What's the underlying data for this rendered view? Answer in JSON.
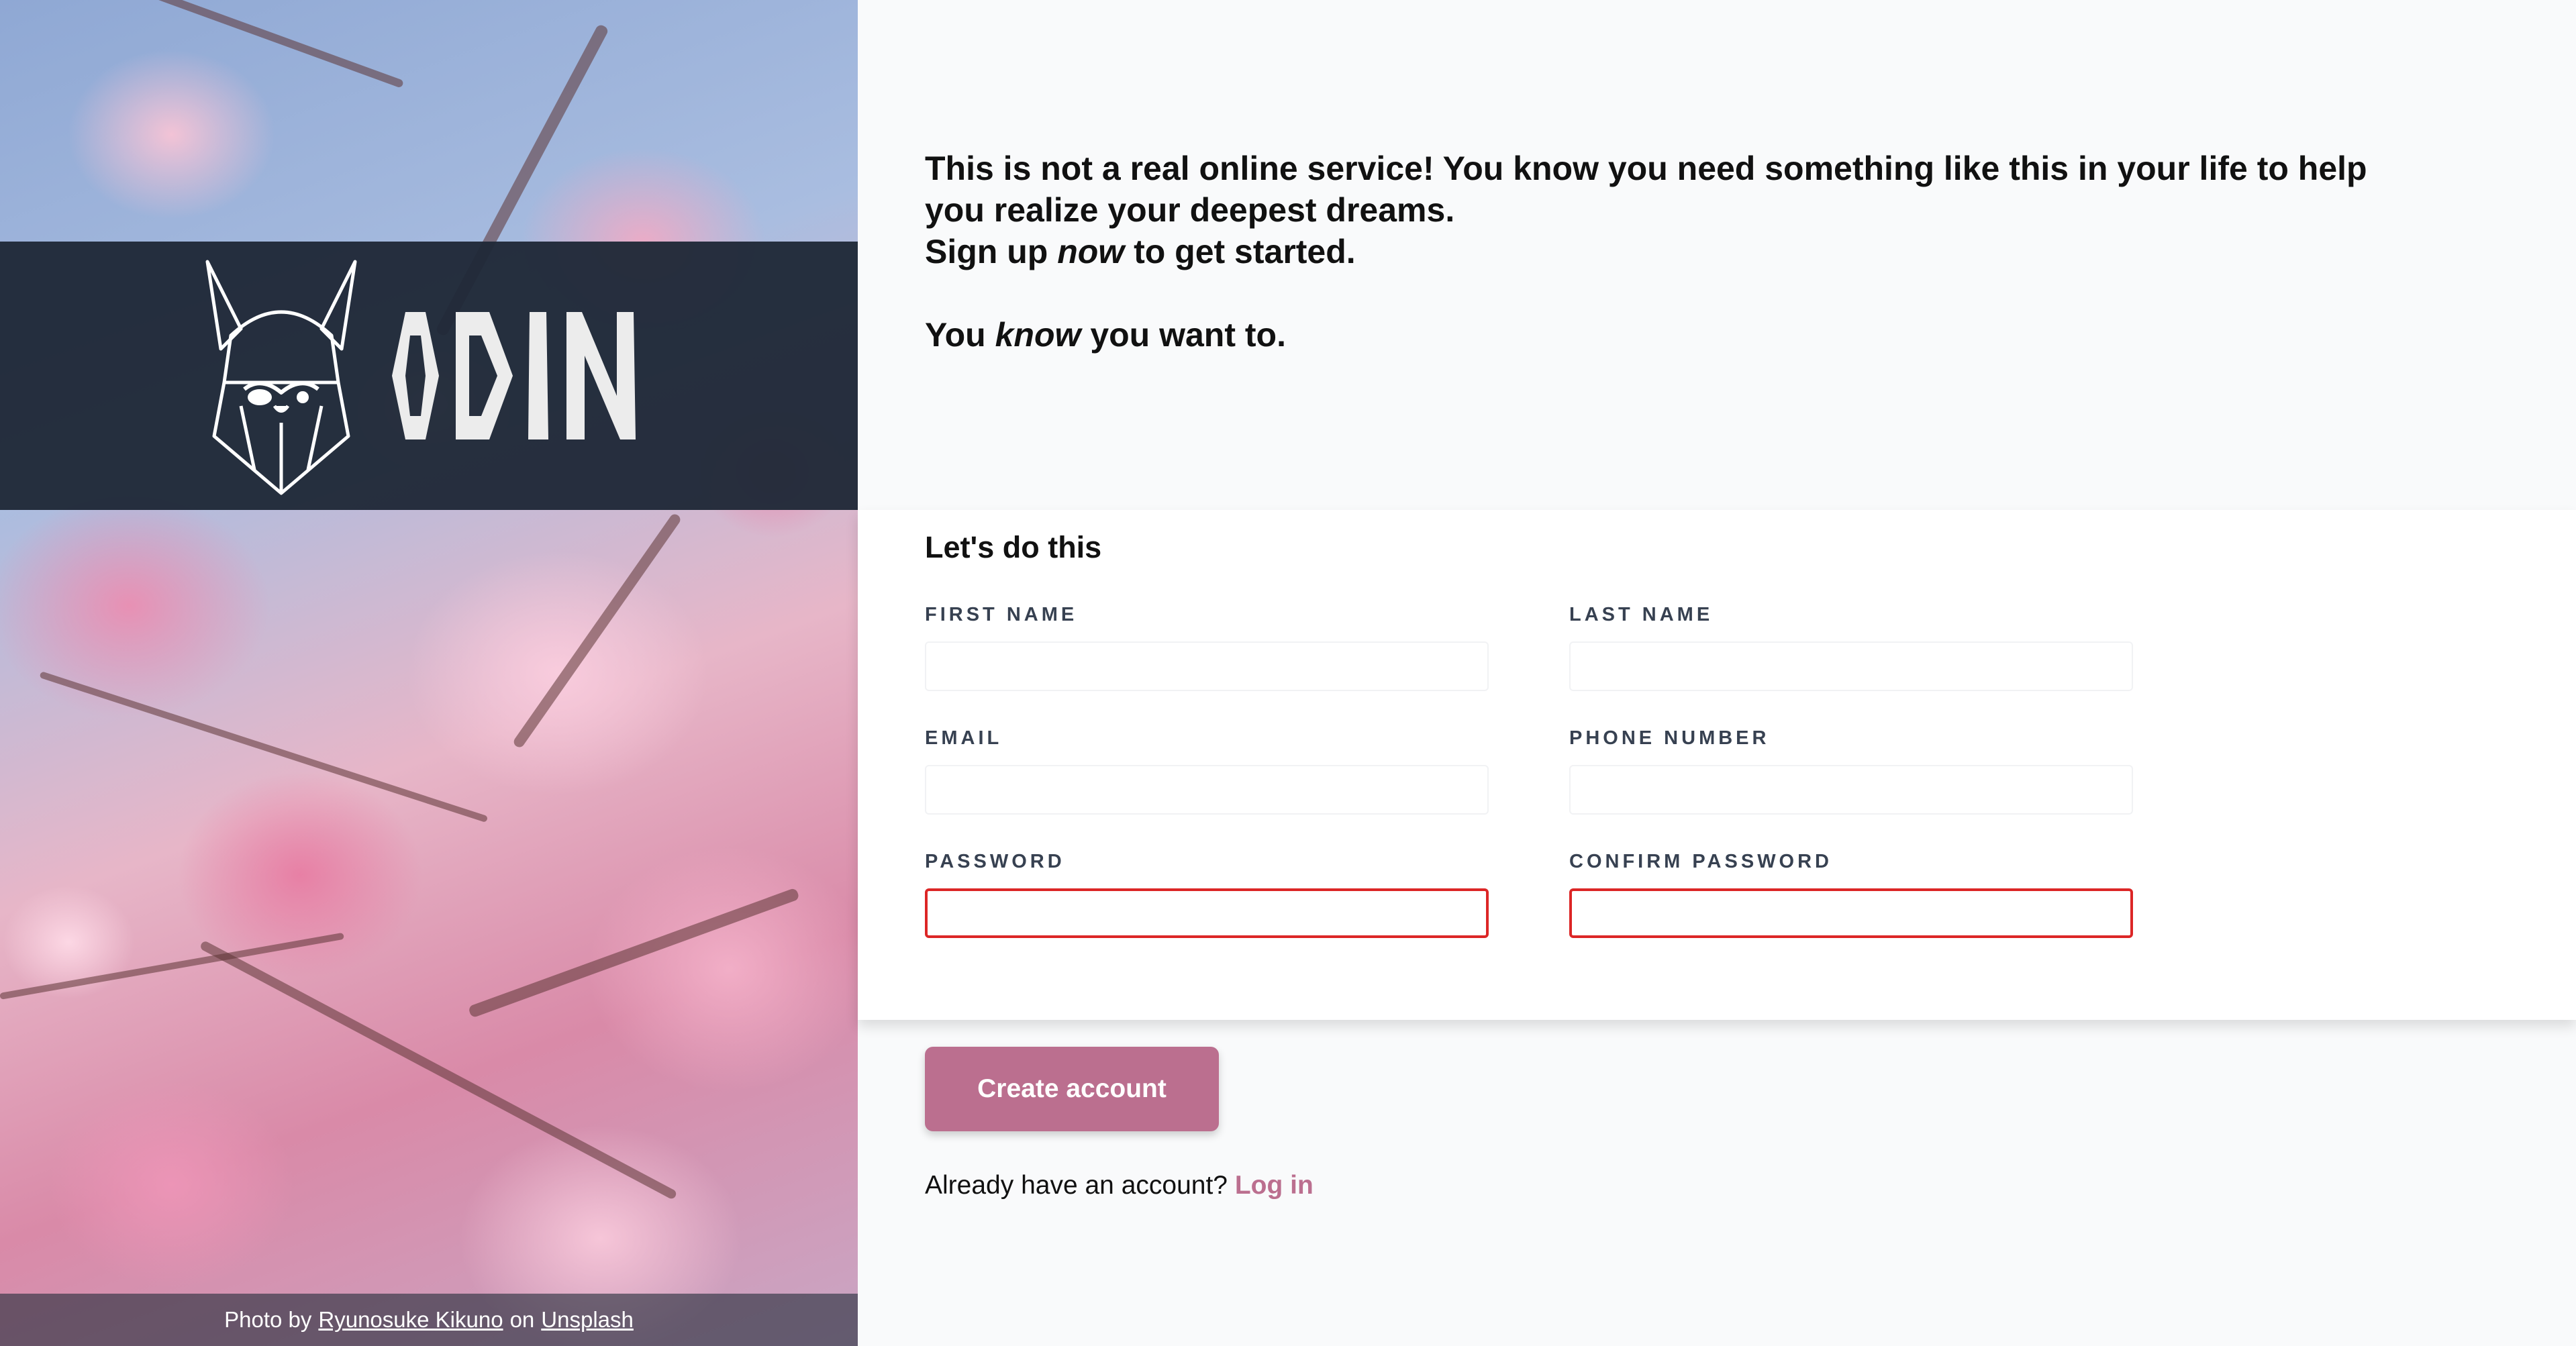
{
  "brand": {
    "name": "ODIN",
    "colors": {
      "accent": "#bb6f8f",
      "dark_band": "#1f2937",
      "error": "#dc2626",
      "page_bg": "#f9fafb"
    }
  },
  "hero": {
    "logo_icon": "viking-helmet-logo-icon",
    "credit": {
      "prefix": "Photo by",
      "author": "Ryunosuke Kikuno",
      "middle": "on",
      "site": "Unsplash"
    }
  },
  "intro": {
    "line1": "This is not a real online service! You know you need something like this in your life to help you realize your deepest dreams.",
    "line2_pre": "Sign up ",
    "line2_em": "now",
    "line2_post": " to get started.",
    "line3_pre": "You ",
    "line3_em": "know",
    "line3_post": " you want to."
  },
  "form": {
    "heading": "Let's do this",
    "fields": {
      "first_name": {
        "label": "FIRST NAME",
        "value": ""
      },
      "last_name": {
        "label": "LAST NAME",
        "value": ""
      },
      "email": {
        "label": "EMAIL",
        "value": ""
      },
      "phone": {
        "label": "PHONE NUMBER",
        "value": ""
      },
      "password": {
        "label": "PASSWORD",
        "value": ""
      },
      "confirm_password": {
        "label": "CONFIRM PASSWORD",
        "value": ""
      }
    },
    "submit_label": "Create account"
  },
  "login": {
    "prompt": "Already have an account? ",
    "link_label": "Log in"
  }
}
